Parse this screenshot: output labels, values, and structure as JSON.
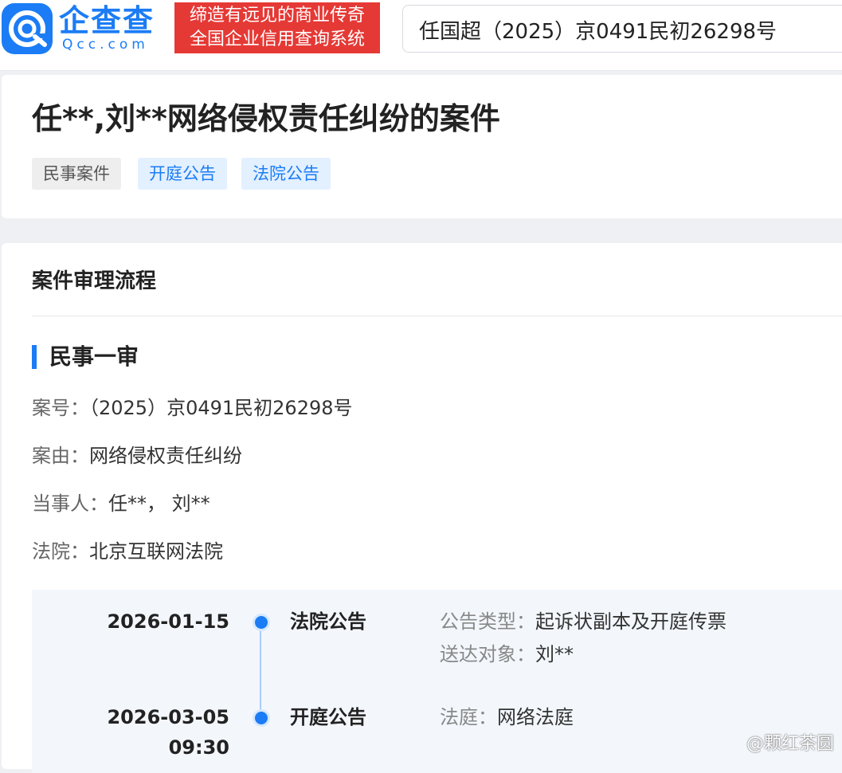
{
  "header": {
    "logo_text": "企查查",
    "logo_sub": "Qcc.com",
    "slogan_line1": "缔造有远见的商业传奇",
    "slogan_line2": "全国企业信用查询系统",
    "search_value": "任国超（2025）京0491民初26298号"
  },
  "case": {
    "title": "任**,刘**网络侵权责任纠纷的案件",
    "tags": [
      "民事案件",
      "开庭公告",
      "法院公告"
    ]
  },
  "process": {
    "section_title": "案件审理流程",
    "stage_title": "民事一审",
    "info": [
      {
        "label": "案号：",
        "value": "（2025）京0491民初26298号"
      },
      {
        "label": "案由：",
        "value": "网络侵权责任纠纷"
      },
      {
        "label": "当事人：",
        "value": "任**， 刘**"
      },
      {
        "label": "法院：",
        "value": "北京互联网法院"
      }
    ],
    "timeline": [
      {
        "date": "2026-01-15",
        "time": "",
        "type": "法院公告",
        "details": [
          {
            "label": "公告类型：",
            "value": "起诉状副本及开庭传票"
          },
          {
            "label": "送达对象：",
            "value": "刘**"
          }
        ]
      },
      {
        "date": "2026-03-05",
        "time": "09:30",
        "type": "开庭公告",
        "details": [
          {
            "label": "法庭：",
            "value": "网络法庭"
          }
        ]
      }
    ]
  },
  "watermark_credit": "@颗红茶圆",
  "colors": {
    "brand": "#1b7cf5",
    "slogan_bg": "#e53935"
  },
  "icons": {
    "logo": "qcc-logo-icon"
  }
}
